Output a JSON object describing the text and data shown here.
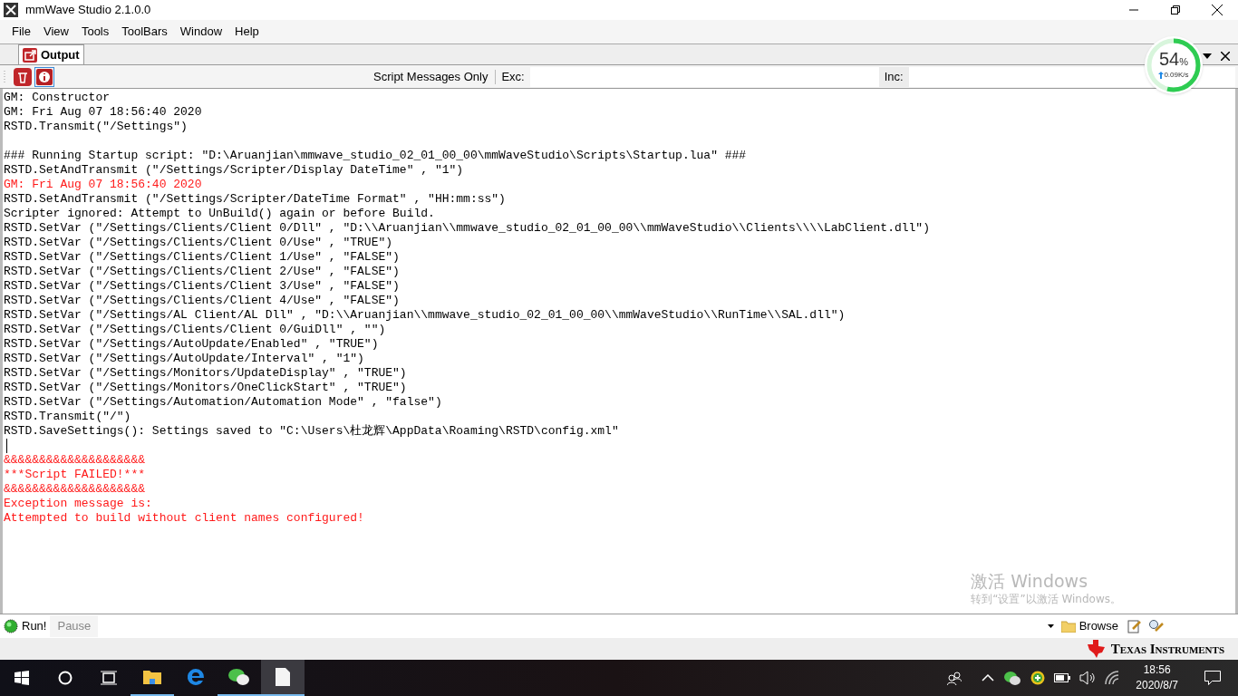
{
  "window": {
    "title": "mmWave Studio 2.1.0.0"
  },
  "menu": [
    "File",
    "View",
    "Tools",
    "ToolBars",
    "Window",
    "Help"
  ],
  "tabs": [
    {
      "label": "Output",
      "selected": true
    }
  ],
  "toolbar": {
    "filter_label": "Script Messages Only",
    "exc_label": "Exc:",
    "inc_label": "Inc:"
  },
  "network_widget": {
    "percent": "54",
    "percent_sign": "%",
    "rate": "0.09K/s",
    "level": 0.54
  },
  "output_lines": [
    {
      "kind": "normal",
      "text": "GM: Constructor"
    },
    {
      "kind": "normal",
      "text": "GM: Fri Aug 07 18:56:40 2020"
    },
    {
      "kind": "normal",
      "text": "RSTD.Transmit(\"/Settings\")"
    },
    {
      "kind": "blank"
    },
    {
      "kind": "normal",
      "text": "### Running Startup script: \"D:\\Aruanjian\\mmwave_studio_02_01_00_00\\mmWaveStudio\\Scripts\\Startup.lua\" ###"
    },
    {
      "kind": "normal",
      "text": "RSTD.SetAndTransmit (\"/Settings/Scripter/Display DateTime\" , \"1\")"
    },
    {
      "kind": "error",
      "text": "GM: Fri Aug 07 18:56:40 2020"
    },
    {
      "kind": "normal",
      "text": "RSTD.SetAndTransmit (\"/Settings/Scripter/DateTime Format\" , \"HH:mm:ss\")"
    },
    {
      "kind": "normal",
      "text": "Scripter ignored: Attempt to UnBuild() again or before Build."
    },
    {
      "kind": "normal",
      "text": "RSTD.SetVar (\"/Settings/Clients/Client 0/Dll\" , \"D:\\\\Aruanjian\\\\mmwave_studio_02_01_00_00\\\\mmWaveStudio\\\\Clients\\\\\\\\LabClient.dll\")"
    },
    {
      "kind": "normal",
      "text": "RSTD.SetVar (\"/Settings/Clients/Client 0/Use\" , \"TRUE\")"
    },
    {
      "kind": "normal",
      "text": "RSTD.SetVar (\"/Settings/Clients/Client 1/Use\" , \"FALSE\")"
    },
    {
      "kind": "normal",
      "text": "RSTD.SetVar (\"/Settings/Clients/Client 2/Use\" , \"FALSE\")"
    },
    {
      "kind": "normal",
      "text": "RSTD.SetVar (\"/Settings/Clients/Client 3/Use\" , \"FALSE\")"
    },
    {
      "kind": "normal",
      "text": "RSTD.SetVar (\"/Settings/Clients/Client 4/Use\" , \"FALSE\")"
    },
    {
      "kind": "normal",
      "text": "RSTD.SetVar (\"/Settings/AL Client/AL Dll\" , \"D:\\\\Aruanjian\\\\mmwave_studio_02_01_00_00\\\\mmWaveStudio\\\\RunTime\\\\SAL.dll\")"
    },
    {
      "kind": "normal",
      "text": "RSTD.SetVar (\"/Settings/Clients/Client 0/GuiDll\" , \"\")"
    },
    {
      "kind": "normal",
      "text": "RSTD.SetVar (\"/Settings/AutoUpdate/Enabled\" , \"TRUE\")"
    },
    {
      "kind": "normal",
      "text": "RSTD.SetVar (\"/Settings/AutoUpdate/Interval\" , \"1\")"
    },
    {
      "kind": "normal",
      "text": "RSTD.SetVar (\"/Settings/Monitors/UpdateDisplay\" , \"TRUE\")"
    },
    {
      "kind": "normal",
      "text": "RSTD.SetVar (\"/Settings/Monitors/OneClickStart\" , \"TRUE\")"
    },
    {
      "kind": "normal",
      "text": "RSTD.SetVar (\"/Settings/Automation/Automation Mode\" , \"false\")"
    },
    {
      "kind": "normal",
      "text": "RSTD.Transmit(\"/\")"
    },
    {
      "kind": "normal",
      "text": "RSTD.SaveSettings(): Settings saved to \"C:\\Users\\杜龙辉\\AppData\\Roaming\\RSTD\\config.xml\""
    },
    {
      "kind": "cursor"
    },
    {
      "kind": "error",
      "text": "&&&&&&&&&&&&&&&&&&&&"
    },
    {
      "kind": "error",
      "text": "***Script FAILED!***"
    },
    {
      "kind": "error",
      "text": "&&&&&&&&&&&&&&&&&&&&"
    },
    {
      "kind": "error",
      "text": "Exception message is:"
    },
    {
      "kind": "error",
      "text": "Attempted to build without client names configured!"
    }
  ],
  "activation_notice": {
    "title": "激活 Windows",
    "hint": "转到“设置”以激活 Windows。"
  },
  "script_bar": {
    "run": {
      "label": "Run!",
      "disabled": false
    },
    "pause": {
      "label": "Pause",
      "disabled": true
    },
    "browse": "Browse"
  },
  "brand": "Texas Instruments",
  "taskbar": {
    "apps": [
      {
        "kind": "folder",
        "running": true
      },
      {
        "kind": "edge",
        "running": false
      },
      {
        "kind": "wechat",
        "running": true
      },
      {
        "kind": "document",
        "running": true
      }
    ],
    "time": "18:56",
    "date": "2020/8/7"
  }
}
